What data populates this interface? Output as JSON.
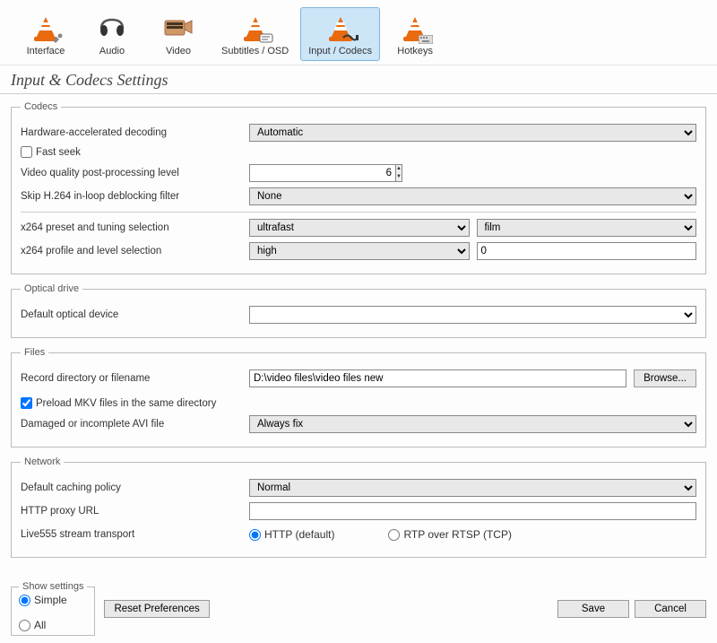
{
  "toolbar": {
    "items": [
      {
        "label": "Interface"
      },
      {
        "label": "Audio"
      },
      {
        "label": "Video"
      },
      {
        "label": "Subtitles / OSD"
      },
      {
        "label": "Input / Codecs"
      },
      {
        "label": "Hotkeys"
      }
    ],
    "selected_index": 4
  },
  "page_title": "Input & Codecs Settings",
  "codecs": {
    "legend": "Codecs",
    "hw_decoding_label": "Hardware-accelerated decoding",
    "hw_decoding_value": "Automatic",
    "fast_seek_label": "Fast seek",
    "fast_seek_checked": false,
    "vq_pp_label": "Video quality post-processing level",
    "vq_pp_value": "6",
    "skip_h264_label": "Skip H.264 in-loop deblocking filter",
    "skip_h264_value": "None",
    "x264_preset_label": "x264 preset and tuning selection",
    "x264_preset_value": "ultrafast",
    "x264_tune_value": "film",
    "x264_profile_label": "x264 profile and level selection",
    "x264_profile_value": "high",
    "x264_level_value": "0"
  },
  "optical": {
    "legend": "Optical drive",
    "default_device_label": "Default optical device",
    "default_device_value": ""
  },
  "files": {
    "legend": "Files",
    "record_dir_label": "Record directory or filename",
    "record_dir_value": "D:\\video files\\video files new",
    "browse_label": "Browse...",
    "preload_mkv_label": "Preload MKV files in the same directory",
    "preload_mkv_checked": true,
    "damaged_avi_label": "Damaged or incomplete AVI file",
    "damaged_avi_value": "Always fix"
  },
  "network": {
    "legend": "Network",
    "caching_label": "Default caching policy",
    "caching_value": "Normal",
    "proxy_label": "HTTP proxy URL",
    "proxy_value": "",
    "live555_label": "Live555 stream transport",
    "live555_opt1": "HTTP (default)",
    "live555_opt2": "RTP over RTSP (TCP)",
    "live555_selected": "http"
  },
  "bottom": {
    "show_settings_legend": "Show settings",
    "simple_label": "Simple",
    "all_label": "All",
    "show_mode": "simple",
    "reset_label": "Reset Preferences",
    "save_label": "Save",
    "cancel_label": "Cancel"
  }
}
